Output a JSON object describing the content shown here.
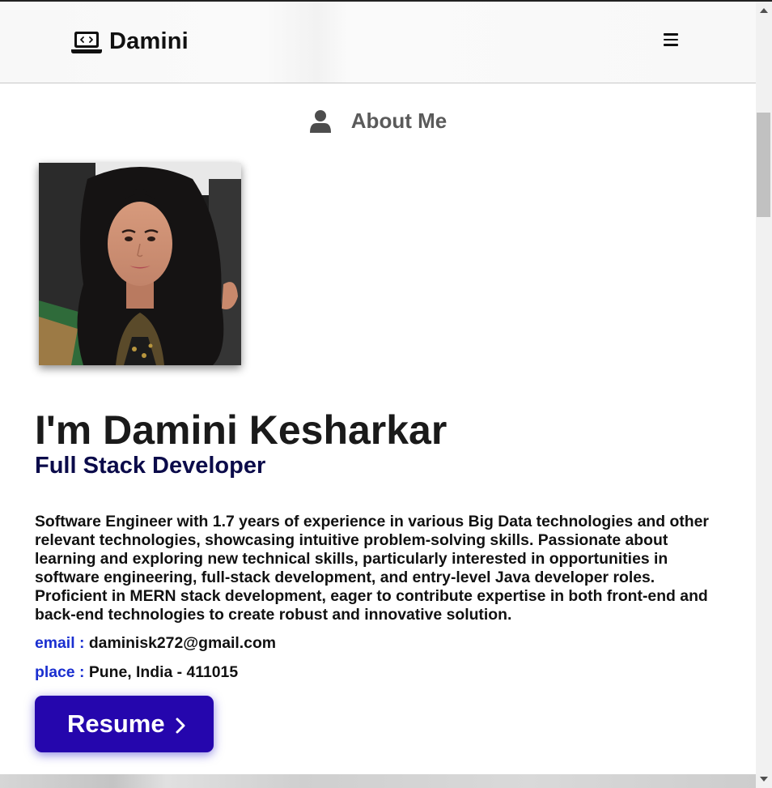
{
  "navbar": {
    "brand_name": "Damini",
    "brand_icon": "laptop-code-icon",
    "menu_icon": "hamburger-menu-icon"
  },
  "about": {
    "section_icon": "user-icon",
    "section_title": "About Me",
    "photo_alt": "Damini Kesharkar",
    "name": "I'm Damini Kesharkar",
    "role": "Full Stack Developer",
    "bio": "Software Engineer with 1.7 years of experience in various Big Data technologies and other relevant technologies, showcasing intuitive problem-solving skills. Passionate about learning and exploring new technical skills, particularly interested in opportunities in software engineering, full-stack development, and entry-level Java developer roles. Proficient in MERN stack development, eager to contribute expertise in both front-end and back-end technologies to create robust and innovative solution.",
    "email_label": "email :",
    "email_value": "daminisk272@gmail.com",
    "place_label": "place :",
    "place_value": "Pune, India - 411015",
    "resume_label": "Resume",
    "resume_icon": "chevron-right-icon"
  },
  "colors": {
    "accent": "#2506ad",
    "label_blue": "#1a2fd0",
    "role_navy": "#0b0b4a",
    "heading_gray": "#5a5a5a"
  }
}
